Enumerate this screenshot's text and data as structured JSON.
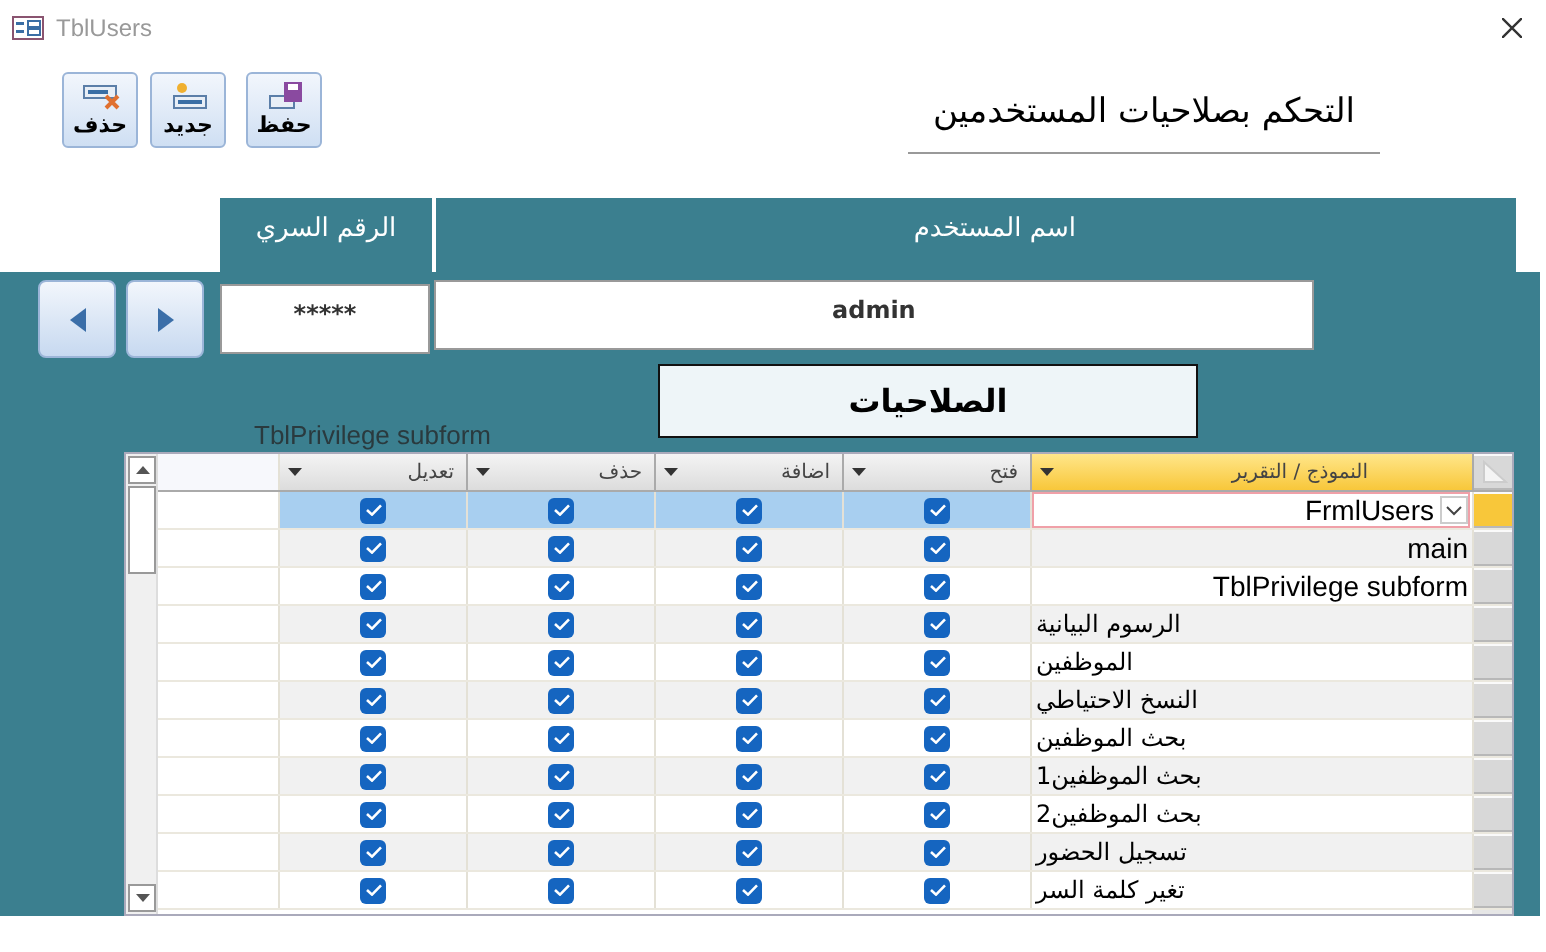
{
  "window": {
    "title": "TblUsers"
  },
  "toolbar": [
    {
      "label": "حفظ",
      "kind": "save"
    },
    {
      "label": "جديد",
      "kind": "new"
    },
    {
      "label": "حذف",
      "kind": "delete"
    }
  ],
  "form_title": "التحكم بصلاحيات المستخدمين",
  "user_fields": [
    {
      "label": "اسم المستخدم",
      "value": "admin"
    },
    {
      "label": "الرقم السري",
      "value": "*****"
    }
  ],
  "navigation": [
    {
      "kind": "previous"
    },
    {
      "kind": "next"
    }
  ],
  "section_title": "الصلاحيات",
  "subform_label": "TblPrivilege subform",
  "grid": {
    "columns": [
      "النموذج / التقرير",
      "فتح",
      "اضافة",
      "حذف",
      "تعديل"
    ],
    "rows": [
      {
        "form": "FrmlUsers",
        "open": true,
        "add": true,
        "delete": true,
        "edit": true,
        "selected": true
      },
      {
        "form": "main",
        "open": true,
        "add": true,
        "delete": true,
        "edit": true,
        "selected": false
      },
      {
        "form": "TblPrivilege subform",
        "open": true,
        "add": true,
        "delete": true,
        "edit": true,
        "selected": false
      },
      {
        "form": "الرسوم البيانية",
        "open": true,
        "add": true,
        "delete": true,
        "edit": true,
        "selected": false
      },
      {
        "form": "الموظفين",
        "open": true,
        "add": true,
        "delete": true,
        "edit": true,
        "selected": false
      },
      {
        "form": "النسخ الاحتياطي",
        "open": true,
        "add": true,
        "delete": true,
        "edit": true,
        "selected": false
      },
      {
        "form": "بحث الموظفين",
        "open": true,
        "add": true,
        "delete": true,
        "edit": true,
        "selected": false
      },
      {
        "form": "بحث الموظفين1",
        "open": true,
        "add": true,
        "delete": true,
        "edit": true,
        "selected": false
      },
      {
        "form": "بحث الموظفين2",
        "open": true,
        "add": true,
        "delete": true,
        "edit": true,
        "selected": false
      },
      {
        "form": "تسجيل الحضور",
        "open": true,
        "add": true,
        "delete": true,
        "edit": true,
        "selected": false
      },
      {
        "form": "تغير كلمة السر",
        "open": true,
        "add": true,
        "delete": true,
        "edit": true,
        "selected": false
      }
    ]
  }
}
